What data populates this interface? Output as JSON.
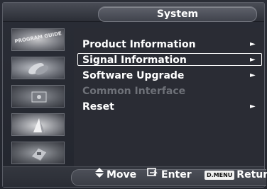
{
  "header": {
    "title": "System"
  },
  "sidebar": {
    "items": [
      {
        "name": "program-guide",
        "label": "PROGRAM GUIDE"
      },
      {
        "name": "channel"
      },
      {
        "name": "picture"
      },
      {
        "name": "sound"
      },
      {
        "name": "setup"
      }
    ]
  },
  "menu": {
    "items": [
      {
        "label": "Product Information",
        "arrow": "►",
        "state": "normal"
      },
      {
        "label": "Signal Information",
        "arrow": "►",
        "state": "selected"
      },
      {
        "label": "Software Upgrade",
        "arrow": "►",
        "state": "normal"
      },
      {
        "label": "Common Interface",
        "arrow": "",
        "state": "disabled"
      },
      {
        "label": "Reset",
        "arrow": "►",
        "state": "normal"
      }
    ]
  },
  "footer": {
    "move_label": "Move",
    "enter_label": "Enter",
    "menu_key": "D.MENU",
    "return_label": "Return"
  },
  "colors": {
    "text": "#ffffff",
    "disabled_text": "#6e7178",
    "panel": "#2a2c34"
  }
}
